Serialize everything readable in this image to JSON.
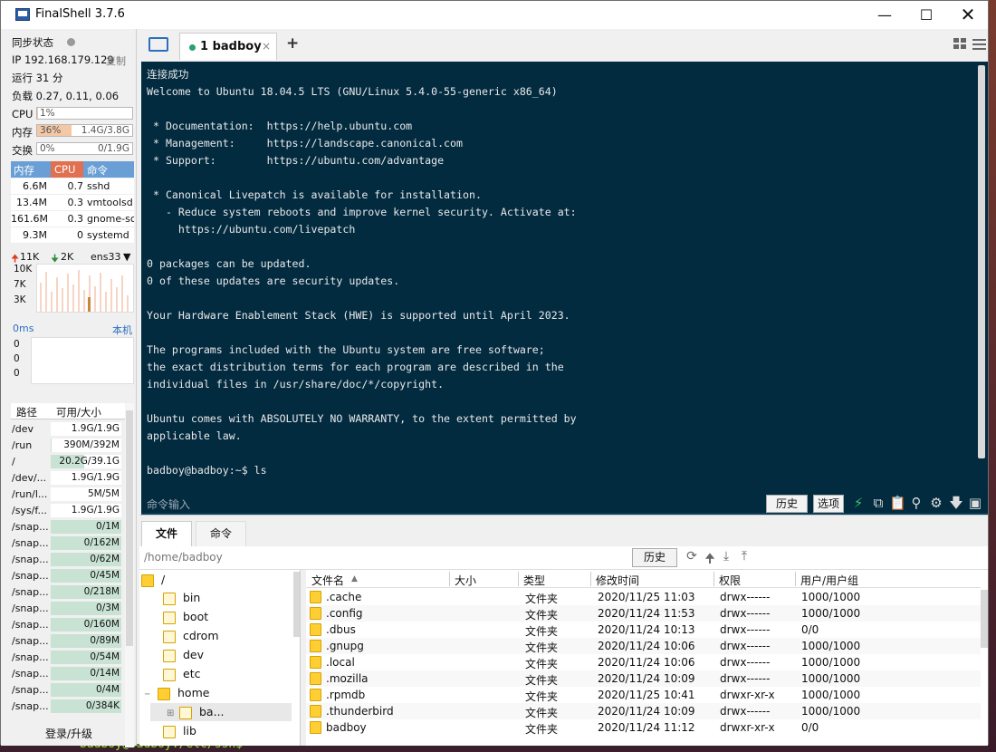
{
  "window": {
    "title": "FinalShell 3.7.6"
  },
  "sidebar": {
    "sync_label": "同步状态",
    "ip": "IP 192.168.179.129",
    "copy": "复制",
    "uptime": "运行 31 分",
    "load": "负载 0.27, 0.11, 0.06",
    "meters": [
      {
        "label": "CPU",
        "pct": "1%",
        "value": "",
        "fraction": 0.01
      },
      {
        "label": "内存",
        "pct": "36%",
        "value": "1.4G/3.8G",
        "fraction": 0.36
      },
      {
        "label": "交换",
        "pct": "0%",
        "value": "0/1.9G",
        "fraction": 0.0
      }
    ],
    "proc_headers": [
      "内存",
      "CPU",
      "命令"
    ],
    "processes": [
      {
        "mem": "6.6M",
        "cpu": "0.7",
        "cmd": "sshd"
      },
      {
        "mem": "13.4M",
        "cpu": "0.3",
        "cmd": "vmtoolsd"
      },
      {
        "mem": "161.6M",
        "cpu": "0.3",
        "cmd": "gnome-sc"
      },
      {
        "mem": "9.3M",
        "cpu": "0",
        "cmd": "systemd"
      }
    ],
    "net": {
      "up": "11K",
      "down": "2K",
      "iface": "ens33",
      "y_ticks": [
        "10K",
        "7K",
        "3K"
      ]
    },
    "latency": {
      "label": "0ms",
      "host": "本机",
      "values": [
        "0",
        "0",
        "0"
      ]
    },
    "disk_headers": [
      "路径",
      "可用/大小"
    ],
    "disks": [
      {
        "path": "/dev",
        "size": "1.9G/1.9G",
        "used": 0.0
      },
      {
        "path": "/run",
        "size": "390M/392M",
        "used": 0.01
      },
      {
        "path": "/",
        "size": "20.2G/39.1G",
        "used": 0.48
      },
      {
        "path": "/dev/...",
        "size": "1.9G/1.9G",
        "used": 0.0
      },
      {
        "path": "/run/l...",
        "size": "5M/5M",
        "used": 0.0
      },
      {
        "path": "/sys/f...",
        "size": "1.9G/1.9G",
        "used": 0.0
      },
      {
        "path": "/snap...",
        "size": "0/1M",
        "used": 1.0
      },
      {
        "path": "/snap...",
        "size": "0/162M",
        "used": 1.0
      },
      {
        "path": "/snap...",
        "size": "0/62M",
        "used": 1.0
      },
      {
        "path": "/snap...",
        "size": "0/45M",
        "used": 1.0
      },
      {
        "path": "/snap...",
        "size": "0/218M",
        "used": 1.0
      },
      {
        "path": "/snap...",
        "size": "0/3M",
        "used": 1.0
      },
      {
        "path": "/snap...",
        "size": "0/160M",
        "used": 1.0
      },
      {
        "path": "/snap...",
        "size": "0/89M",
        "used": 1.0
      },
      {
        "path": "/snap...",
        "size": "0/54M",
        "used": 1.0
      },
      {
        "path": "/snap...",
        "size": "0/14M",
        "used": 1.0
      },
      {
        "path": "/snap...",
        "size": "0/4M",
        "used": 1.0
      },
      {
        "path": "/snap...",
        "size": "0/384K",
        "used": 1.0
      }
    ],
    "login": "登录/升级"
  },
  "session_tab": {
    "label": "1 badboy",
    "close": "×",
    "add": "+"
  },
  "terminal": {
    "lines": [
      "连接成功",
      "Welcome to Ubuntu 18.04.5 LTS (GNU/Linux 5.4.0-55-generic x86_64)",
      "",
      " * Documentation:  https://help.ubuntu.com",
      " * Management:     https://landscape.canonical.com",
      " * Support:        https://ubuntu.com/advantage",
      "",
      " * Canonical Livepatch is available for installation.",
      "   - Reduce system reboots and improve kernel security. Activate at:",
      "     https://ubuntu.com/livepatch",
      "",
      "0 packages can be updated.",
      "0 of these updates are security updates.",
      "",
      "Your Hardware Enablement Stack (HWE) is supported until April 2023.",
      "",
      "The programs included with the Ubuntu system are free software;",
      "the exact distribution terms for each program are described in the",
      "individual files in /usr/share/doc/*/copyright.",
      "",
      "Ubuntu comes with ABSOLUTELY NO WARRANTY, to the extent permitted by",
      "applicable law.",
      "",
      "badboy@badboy:~$ ls"
    ],
    "cmd_placeholder": "命令输入",
    "history": "历史",
    "options": "选项"
  },
  "lower_tabs": {
    "files": "文件",
    "commands": "命令"
  },
  "path": {
    "current": "/home/badboy",
    "history": "历史"
  },
  "tree": {
    "root": "/",
    "items": [
      "bin",
      "boot",
      "cdrom",
      "dev",
      "etc",
      "home"
    ],
    "selected": "ba...",
    "last": "lib"
  },
  "files": {
    "headers": [
      "文件名",
      "大小",
      "类型",
      "修改时间",
      "权限",
      "用户/用户组"
    ],
    "rows": [
      {
        "name": ".cache",
        "size": "",
        "type": "文件夹",
        "mtime": "2020/11/25 11:03",
        "perm": "drwx------",
        "owner": "1000/1000"
      },
      {
        "name": ".config",
        "size": "",
        "type": "文件夹",
        "mtime": "2020/11/24 11:53",
        "perm": "drwx------",
        "owner": "1000/1000"
      },
      {
        "name": ".dbus",
        "size": "",
        "type": "文件夹",
        "mtime": "2020/11/24 10:13",
        "perm": "drwx------",
        "owner": "0/0"
      },
      {
        "name": ".gnupg",
        "size": "",
        "type": "文件夹",
        "mtime": "2020/11/24 10:06",
        "perm": "drwx------",
        "owner": "1000/1000"
      },
      {
        "name": ".local",
        "size": "",
        "type": "文件夹",
        "mtime": "2020/11/24 10:06",
        "perm": "drwx------",
        "owner": "1000/1000"
      },
      {
        "name": ".mozilla",
        "size": "",
        "type": "文件夹",
        "mtime": "2020/11/24 10:09",
        "perm": "drwx------",
        "owner": "1000/1000"
      },
      {
        "name": ".rpmdb",
        "size": "",
        "type": "文件夹",
        "mtime": "2020/11/25 10:41",
        "perm": "drwxr-xr-x",
        "owner": "1000/1000"
      },
      {
        "name": ".thunderbird",
        "size": "",
        "type": "文件夹",
        "mtime": "2020/11/24 10:09",
        "perm": "drwx------",
        "owner": "1000/1000"
      },
      {
        "name": "badboy",
        "size": "",
        "type": "文件夹",
        "mtime": "2020/11/24 11:12",
        "perm": "drwxr-xr-x",
        "owner": "0/0"
      }
    ]
  },
  "desktop": {
    "terminal_fragment": "badboy@badboy:/etc/ssh$"
  },
  "colors": {
    "terminal_bg": "#032b40",
    "accent": "#6a9fd6",
    "cpu_header": "#e07050",
    "mem_fill": "#f4c7a5",
    "disk_fill": "#c8e2d4",
    "status_dot": "#26a269"
  }
}
